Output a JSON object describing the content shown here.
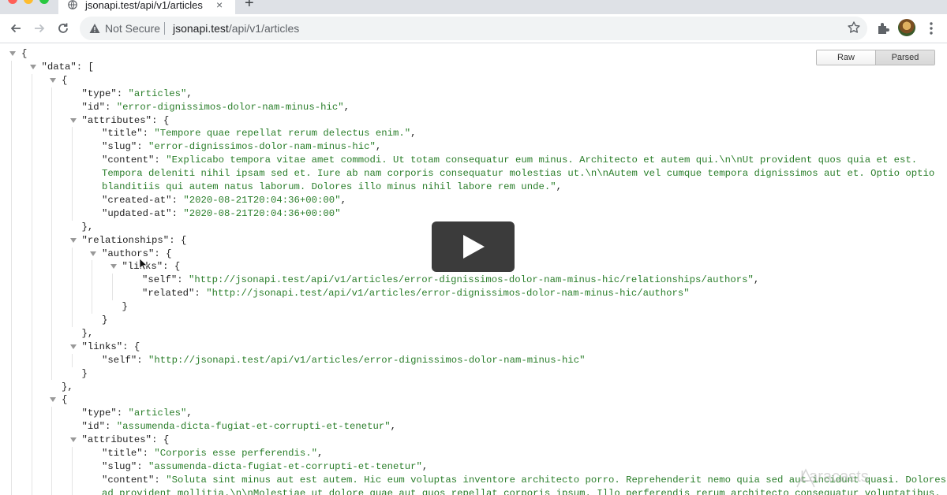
{
  "browser": {
    "tab_title": "jsonapi.test/api/v1/articles",
    "tab_close": "×",
    "new_tab": "+",
    "not_secure_label": "Not Secure",
    "url_host": "jsonapi.test",
    "url_path": "/api/v1/articles",
    "traffic_light_colors": [
      "#ff5f57",
      "#febc2e",
      "#28c840"
    ]
  },
  "viewer": {
    "raw_label": "Raw",
    "parsed_label": "Parsed",
    "active_view": "Parsed",
    "json_lines": [
      {
        "d": 0,
        "t": true,
        "parts": [
          [
            "p",
            "{"
          ]
        ]
      },
      {
        "d": 1,
        "t": true,
        "parts": [
          [
            "k",
            "\"data\""
          ],
          [
            "p",
            ": ["
          ]
        ]
      },
      {
        "d": 2,
        "t": true,
        "parts": [
          [
            "p",
            "{"
          ]
        ]
      },
      {
        "d": 3,
        "t": false,
        "parts": [
          [
            "k",
            "\"type\""
          ],
          [
            "p",
            ": "
          ],
          [
            "s",
            "\"articles\""
          ],
          [
            "p",
            ","
          ]
        ]
      },
      {
        "d": 3,
        "t": false,
        "parts": [
          [
            "k",
            "\"id\""
          ],
          [
            "p",
            ": "
          ],
          [
            "s",
            "\"error-dignissimos-dolor-nam-minus-hic\""
          ],
          [
            "p",
            ","
          ]
        ]
      },
      {
        "d": 3,
        "t": true,
        "parts": [
          [
            "k",
            "\"attributes\""
          ],
          [
            "p",
            ": {"
          ]
        ]
      },
      {
        "d": 4,
        "t": false,
        "parts": [
          [
            "k",
            "\"title\""
          ],
          [
            "p",
            ": "
          ],
          [
            "s",
            "\"Tempore quae repellat rerum delectus enim.\""
          ],
          [
            "p",
            ","
          ]
        ]
      },
      {
        "d": 4,
        "t": false,
        "parts": [
          [
            "k",
            "\"slug\""
          ],
          [
            "p",
            ": "
          ],
          [
            "s",
            "\"error-dignissimos-dolor-nam-minus-hic\""
          ],
          [
            "p",
            ","
          ]
        ]
      },
      {
        "d": 4,
        "t": false,
        "parts": [
          [
            "k",
            "\"content\""
          ],
          [
            "p",
            ": "
          ],
          [
            "s",
            "\"Explicabo tempora vitae amet commodi. Ut totam consequatur eum minus. Architecto et autem qui.\\n\\nUt provident quos quia et est."
          ]
        ]
      },
      {
        "d": 4,
        "t": false,
        "parts": [
          [
            "s",
            "Tempora deleniti nihil ipsam sed et. Iure ab nam corporis consequatur molestias ut.\\n\\nAutem vel cumque tempora dignissimos aut et. Optio optio"
          ]
        ]
      },
      {
        "d": 4,
        "t": false,
        "parts": [
          [
            "s",
            "blanditiis qui autem natus laborum. Dolores illo minus nihil labore rem unde.\""
          ],
          [
            "p",
            ","
          ]
        ]
      },
      {
        "d": 4,
        "t": false,
        "parts": [
          [
            "k",
            "\"created-at\""
          ],
          [
            "p",
            ": "
          ],
          [
            "s",
            "\"2020-08-21T20:04:36+00:00\""
          ],
          [
            "p",
            ","
          ]
        ]
      },
      {
        "d": 4,
        "t": false,
        "parts": [
          [
            "k",
            "\"updated-at\""
          ],
          [
            "p",
            ": "
          ],
          [
            "s",
            "\"2020-08-21T20:04:36+00:00\""
          ]
        ]
      },
      {
        "d": 3,
        "t": false,
        "parts": [
          [
            "p",
            "},"
          ]
        ]
      },
      {
        "d": 3,
        "t": true,
        "parts": [
          [
            "k",
            "\"relationships\""
          ],
          [
            "p",
            ": {"
          ]
        ]
      },
      {
        "d": 4,
        "t": true,
        "parts": [
          [
            "k",
            "\"authors\""
          ],
          [
            "p",
            ": {"
          ]
        ]
      },
      {
        "d": 5,
        "t": true,
        "parts": [
          [
            "k",
            "\"links\""
          ],
          [
            "p",
            ": {"
          ]
        ]
      },
      {
        "d": 6,
        "t": false,
        "parts": [
          [
            "k",
            "\"self\""
          ],
          [
            "p",
            ": "
          ],
          [
            "s",
            "\"http://jsonapi.test/api/v1/articles/error-dignissimos-dolor-nam-minus-hic/relationships/authors\""
          ],
          [
            "p",
            ","
          ]
        ]
      },
      {
        "d": 6,
        "t": false,
        "parts": [
          [
            "k",
            "\"related\""
          ],
          [
            "p",
            ": "
          ],
          [
            "s",
            "\"http://jsonapi.test/api/v1/articles/error-dignissimos-dolor-nam-minus-hic/authors\""
          ]
        ]
      },
      {
        "d": 5,
        "t": false,
        "parts": [
          [
            "p",
            "}"
          ]
        ]
      },
      {
        "d": 4,
        "t": false,
        "parts": [
          [
            "p",
            "}"
          ]
        ]
      },
      {
        "d": 3,
        "t": false,
        "parts": [
          [
            "p",
            "},"
          ]
        ]
      },
      {
        "d": 3,
        "t": true,
        "parts": [
          [
            "k",
            "\"links\""
          ],
          [
            "p",
            ": {"
          ]
        ]
      },
      {
        "d": 4,
        "t": false,
        "parts": [
          [
            "k",
            "\"self\""
          ],
          [
            "p",
            ": "
          ],
          [
            "s",
            "\"http://jsonapi.test/api/v1/articles/error-dignissimos-dolor-nam-minus-hic\""
          ]
        ]
      },
      {
        "d": 3,
        "t": false,
        "parts": [
          [
            "p",
            "}"
          ]
        ]
      },
      {
        "d": 2,
        "t": false,
        "parts": [
          [
            "p",
            "},"
          ]
        ]
      },
      {
        "d": 2,
        "t": true,
        "parts": [
          [
            "p",
            "{"
          ]
        ]
      },
      {
        "d": 3,
        "t": false,
        "parts": [
          [
            "k",
            "\"type\""
          ],
          [
            "p",
            ": "
          ],
          [
            "s",
            "\"articles\""
          ],
          [
            "p",
            ","
          ]
        ]
      },
      {
        "d": 3,
        "t": false,
        "parts": [
          [
            "k",
            "\"id\""
          ],
          [
            "p",
            ": "
          ],
          [
            "s",
            "\"assumenda-dicta-fugiat-et-corrupti-et-tenetur\""
          ],
          [
            "p",
            ","
          ]
        ]
      },
      {
        "d": 3,
        "t": true,
        "parts": [
          [
            "k",
            "\"attributes\""
          ],
          [
            "p",
            ": {"
          ]
        ]
      },
      {
        "d": 4,
        "t": false,
        "parts": [
          [
            "k",
            "\"title\""
          ],
          [
            "p",
            ": "
          ],
          [
            "s",
            "\"Corporis esse perferendis.\""
          ],
          [
            "p",
            ","
          ]
        ]
      },
      {
        "d": 4,
        "t": false,
        "parts": [
          [
            "k",
            "\"slug\""
          ],
          [
            "p",
            ": "
          ],
          [
            "s",
            "\"assumenda-dicta-fugiat-et-corrupti-et-tenetur\""
          ],
          [
            "p",
            ","
          ]
        ]
      },
      {
        "d": 4,
        "t": false,
        "parts": [
          [
            "k",
            "\"content\""
          ],
          [
            "p",
            ": "
          ],
          [
            "s",
            "\"Soluta sint minus aut est autem. Hic eum voluptas inventore architecto porro. Reprehenderit nemo quia sed aut incidunt quasi. Dolores"
          ]
        ]
      },
      {
        "d": 4,
        "t": false,
        "parts": [
          [
            "s",
            "ad provident mollitia.\\n\\nMolestiae ut dolore quae aut quos repellat corporis ipsum. Illo perferendis rerum architecto consequatur voluptatibus."
          ]
        ]
      }
    ]
  },
  "overlay": {
    "watermark_text": "Laracasts"
  },
  "colors": {
    "json_string": "#2a7e2a",
    "json_key": "#222222",
    "play_button": "#3b3b3b"
  }
}
